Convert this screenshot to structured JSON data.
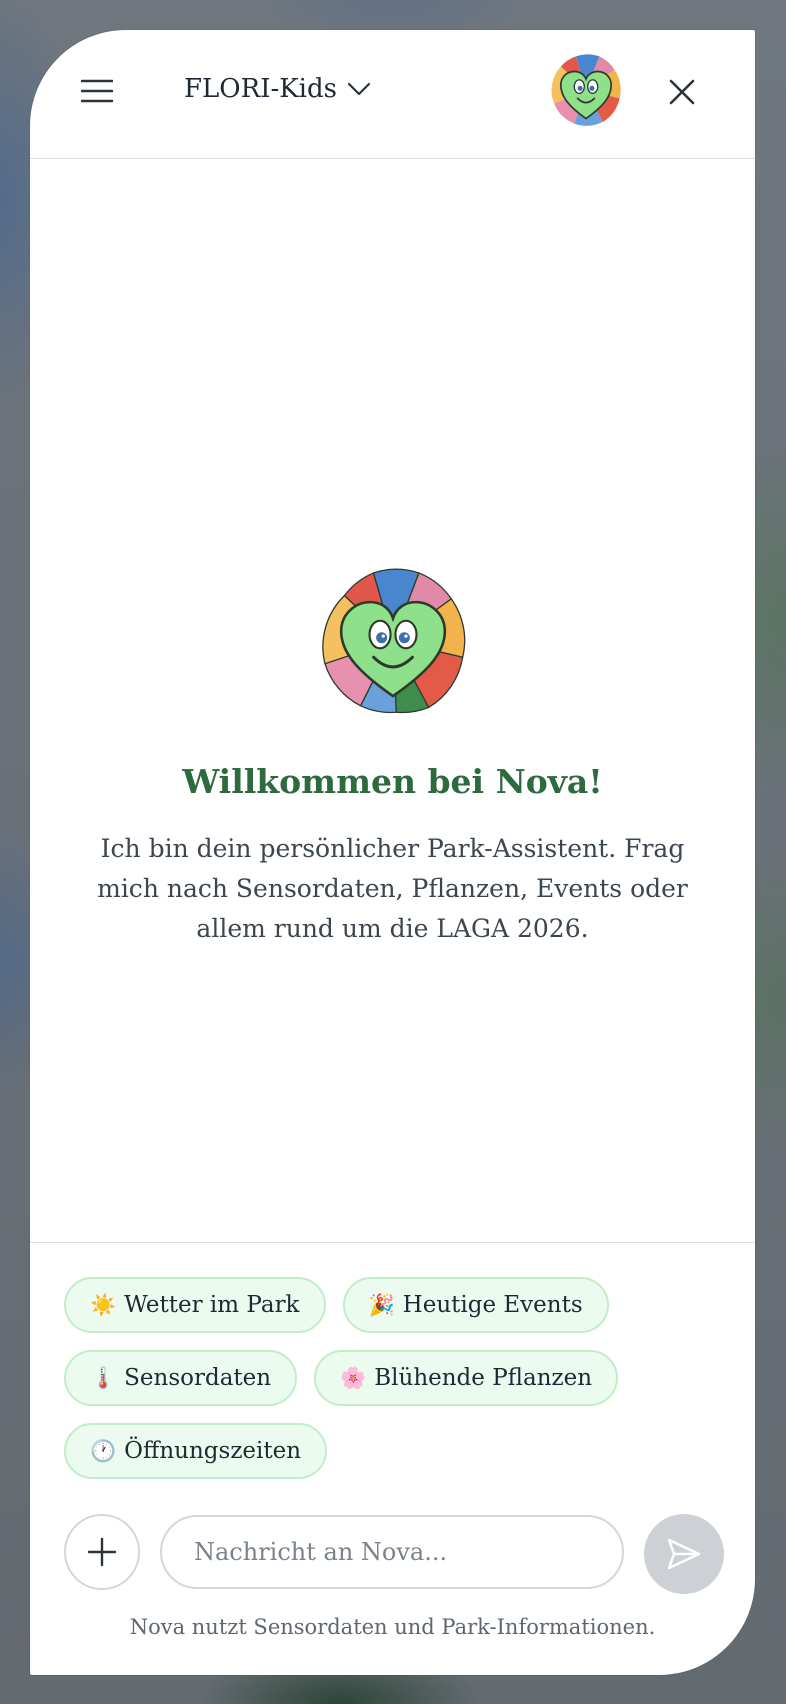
{
  "header": {
    "title": "FLORI-Kids",
    "menu_icon": "hamburger-menu-icon",
    "dropdown_icon": "chevron-down-icon",
    "avatar_icon": "nova-mascot-avatar",
    "close_icon": "close-icon"
  },
  "welcome": {
    "title": "Willkommen bei Nova!",
    "text": "Ich bin dein persönlicher Park-Assistent. Frag mich nach Sensordaten, Pflanzen, Events oder allem rund um die LAGA 2026."
  },
  "suggestions": [
    {
      "emoji": "☀️",
      "label": "Wetter im Park"
    },
    {
      "emoji": "🎉",
      "label": "Heutige Events"
    },
    {
      "emoji": "🌡️",
      "label": "Sensordaten"
    },
    {
      "emoji": "🌸",
      "label": "Blühende Pflanzen"
    },
    {
      "emoji": "🕐",
      "label": "Öffnungszeiten"
    }
  ],
  "composer": {
    "placeholder": "Nachricht an Nova...",
    "attach_icon": "plus-icon",
    "send_icon": "send-icon"
  },
  "footer": {
    "note": "Nova nutzt Sensordaten und Park-Informationen."
  },
  "colors": {
    "accent_green": "#2d6a3e",
    "chip_bg": "#ecfbef",
    "chip_border": "#c3ecc9",
    "send_disabled": "#cdd1d6"
  }
}
